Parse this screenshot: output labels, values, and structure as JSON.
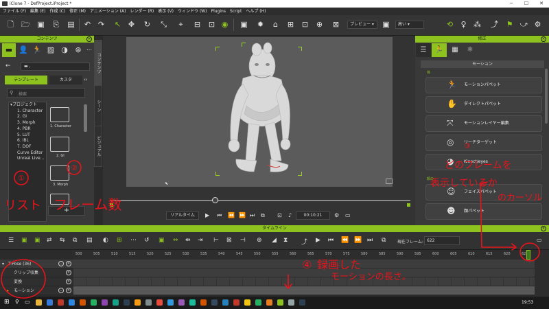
{
  "window": {
    "title": "iClone 7 - DefProject.iProject *"
  },
  "menu": [
    "ファイル (F)",
    "編集 (E)",
    "作成 (C)",
    "修正 (M)",
    "アニメーション (A)",
    "レンダー (R)",
    "表示 (V)",
    "ウィンドウ (W)",
    "Plugins",
    "Script",
    "ヘルプ (H)"
  ],
  "toolbar": {
    "preview_mode": "プレビュー",
    "quality": "高い"
  },
  "left_panel": {
    "title": "コンテンツ",
    "tabs": {
      "template": "テンプレート",
      "custom": "カスタ"
    },
    "search_placeholder": "検索",
    "tree": [
      "▾プロジェクト",
      "1. Character",
      "2. GI",
      "3. Morph",
      "4. PBR",
      "5. LUT",
      "6. IBL",
      "7. DOF",
      "Curve Editor",
      "Unreal Live..."
    ],
    "thumbs": [
      "1. Character",
      "2. GI",
      "3. Morph"
    ]
  },
  "side_tabs": [
    "コンテンツ",
    "シーン",
    "ビジュアル"
  ],
  "viewport": {
    "realtime_label": "リアルタイム",
    "timecode": "00:10:21"
  },
  "right_panel": {
    "title": "修正",
    "section": "モーション",
    "subsection_body": "体",
    "subsection_face": "顔の",
    "buttons": [
      "モーションパペット",
      "ダイレクトパペット",
      "モーションレイヤー編集",
      "リーチターゲット",
      "Kinect/eyes",
      "フェイスパペット",
      "顔パペット"
    ]
  },
  "timeline": {
    "title": "タイムライン",
    "current_frame_label": "現在フレーム:",
    "current_frame": "622",
    "ruler": [
      "500",
      "505",
      "510",
      "515",
      "520",
      "525",
      "530",
      "535",
      "540",
      "545",
      "550",
      "555",
      "560",
      "565",
      "570",
      "575",
      "580",
      "585",
      "590",
      "595",
      "600",
      "605",
      "610",
      "615",
      "620",
      "625"
    ],
    "tracks": [
      "T-Pose (36)",
      "クリップ収集",
      "変換",
      "モーション"
    ]
  },
  "taskbar": {
    "time": "19:53"
  },
  "annotations": {
    "list": "リスト",
    "frames": "フレーム数",
    "n1": "①",
    "n2": "②",
    "n3": "③",
    "n4": "④",
    "note3_line1": "どのフレームを",
    "note3_line2": "表示しているか",
    "note3_line3": "のカーソル",
    "note4": "録画した",
    "note4b": "モーションの長さ。"
  },
  "colors": {
    "accent": "#8dc21f",
    "annotation": "#e8141c"
  }
}
